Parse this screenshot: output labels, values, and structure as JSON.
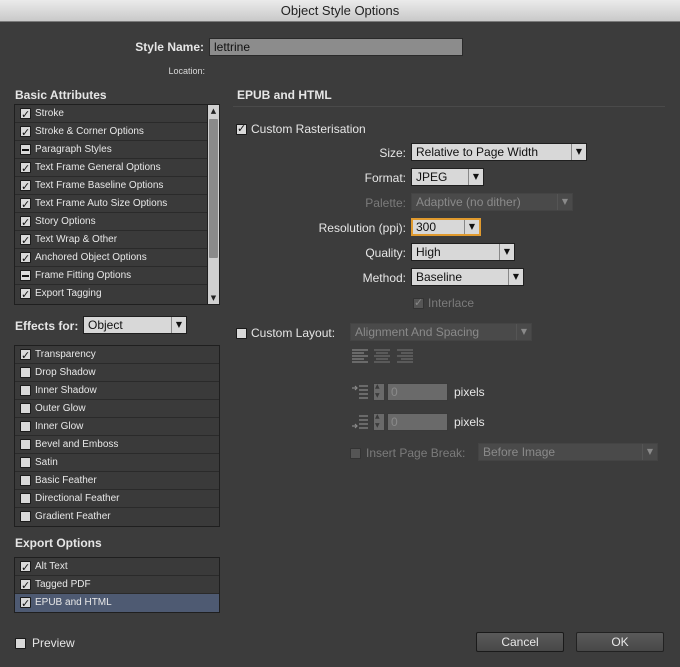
{
  "window": {
    "title": "Object Style Options"
  },
  "style_name": {
    "label": "Style Name:",
    "value": "lettrine"
  },
  "location": {
    "label": "Location:"
  },
  "basic_attributes": {
    "heading": "Basic Attributes",
    "items": [
      {
        "label": "Stroke",
        "state": "checked"
      },
      {
        "label": "Stroke & Corner Options",
        "state": "checked"
      },
      {
        "label": "Paragraph Styles",
        "state": "mixed"
      },
      {
        "label": "Text Frame General Options",
        "state": "checked"
      },
      {
        "label": "Text Frame Baseline Options",
        "state": "checked"
      },
      {
        "label": "Text Frame Auto Size Options",
        "state": "checked"
      },
      {
        "label": "Story Options",
        "state": "checked"
      },
      {
        "label": "Text Wrap & Other",
        "state": "checked"
      },
      {
        "label": "Anchored Object Options",
        "state": "checked"
      },
      {
        "label": "Frame Fitting Options",
        "state": "mixed"
      },
      {
        "label": "Export Tagging",
        "state": "checked"
      }
    ]
  },
  "effects_for": {
    "label": "Effects for:",
    "value": "Object"
  },
  "effects": {
    "items": [
      {
        "label": "Transparency",
        "state": "checked"
      },
      {
        "label": "Drop Shadow",
        "state": "unchecked"
      },
      {
        "label": "Inner Shadow",
        "state": "unchecked"
      },
      {
        "label": "Outer Glow",
        "state": "unchecked"
      },
      {
        "label": "Inner Glow",
        "state": "unchecked"
      },
      {
        "label": "Bevel and Emboss",
        "state": "unchecked"
      },
      {
        "label": "Satin",
        "state": "unchecked"
      },
      {
        "label": "Basic Feather",
        "state": "unchecked"
      },
      {
        "label": "Directional Feather",
        "state": "unchecked"
      },
      {
        "label": "Gradient Feather",
        "state": "unchecked"
      }
    ]
  },
  "export_options": {
    "heading": "Export Options",
    "items": [
      {
        "label": "Alt Text",
        "state": "checked",
        "selected": false
      },
      {
        "label": "Tagged PDF",
        "state": "checked",
        "selected": false
      },
      {
        "label": "EPUB and HTML",
        "state": "checked",
        "selected": true
      }
    ]
  },
  "panel": {
    "heading": "EPUB and HTML",
    "custom_rasterisation": {
      "label": "Custom Rasterisation",
      "checked": true
    },
    "size": {
      "label": "Size:",
      "value": "Relative to Page Width"
    },
    "format": {
      "label": "Format:",
      "value": "JPEG"
    },
    "palette": {
      "label": "Palette:",
      "value": "Adaptive (no dither)"
    },
    "resolution": {
      "label": "Resolution (ppi):",
      "value": "300"
    },
    "quality": {
      "label": "Quality:",
      "value": "High"
    },
    "method": {
      "label": "Method:",
      "value": "Baseline"
    },
    "interlace": {
      "label": "Interlace",
      "checked": true
    },
    "custom_layout": {
      "label": "Custom Layout:",
      "checked": false,
      "value": "Alignment And Spacing"
    },
    "space_before": {
      "value": "0",
      "unit": "pixels"
    },
    "space_after": {
      "value": "0",
      "unit": "pixels"
    },
    "insert_page_break": {
      "label": "Insert Page Break:",
      "checked": false,
      "value": "Before Image"
    }
  },
  "footer": {
    "preview": {
      "label": "Preview",
      "checked": false
    },
    "cancel_label": "Cancel",
    "ok_label": "OK"
  },
  "colors": {
    "background": "#3c3c3c",
    "selection": "#4e5a72",
    "focus": "#e09a2e"
  }
}
